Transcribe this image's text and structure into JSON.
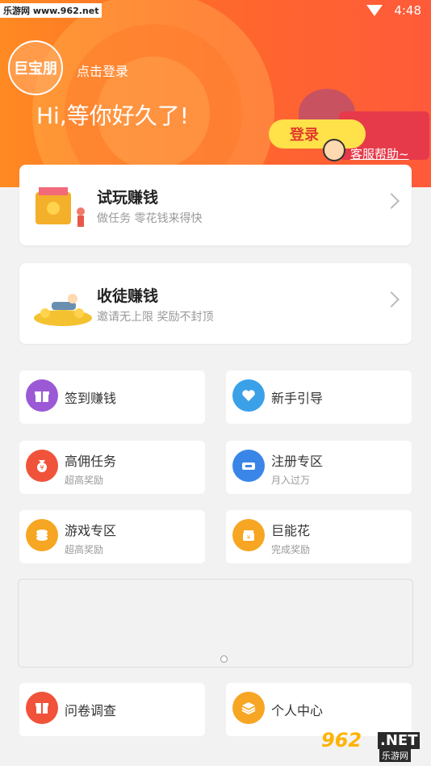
{
  "status": {
    "watermark": "乐游网 www.962.net",
    "time": "4:48"
  },
  "header": {
    "avatar_text": "巨宝朋",
    "login_link": "点击登录",
    "greeting": "Hi,等你好久了!",
    "promo_button": "登录",
    "promo_help": "客服帮助~"
  },
  "cards": [
    {
      "title": "试玩赚钱",
      "subtitle": "做任务 零花钱来得快"
    },
    {
      "title": "收徒赚钱",
      "subtitle": "邀请无上限 奖励不封顶"
    }
  ],
  "tiles": [
    {
      "label": "签到赚钱",
      "sub": "",
      "icon": "gift-icon",
      "color": "#9b59d6"
    },
    {
      "label": "新手引导",
      "sub": "",
      "icon": "heart-icon",
      "color": "#3aa0e8"
    },
    {
      "label": "高佣任务",
      "sub": "超高奖励",
      "icon": "money-bag-icon",
      "color": "#f0533a"
    },
    {
      "label": "注册专区",
      "sub": "月入过万",
      "icon": "ticket-icon",
      "color": "#3a86e8"
    },
    {
      "label": "游戏专区",
      "sub": "超高奖励",
      "icon": "coins-icon",
      "color": "#f6a623"
    },
    {
      "label": "巨能花",
      "sub": "完成奖励",
      "icon": "jar-icon",
      "color": "#f6a623"
    },
    {
      "label": "问卷调查",
      "sub": "",
      "icon": "box-icon",
      "color": "#f0533a"
    },
    {
      "label": "个人中心",
      "sub": "",
      "icon": "layers-icon",
      "color": "#f6a623"
    }
  ],
  "footer_logo": {
    "number": "962",
    "net": ".NET",
    "cn": "乐游网"
  }
}
